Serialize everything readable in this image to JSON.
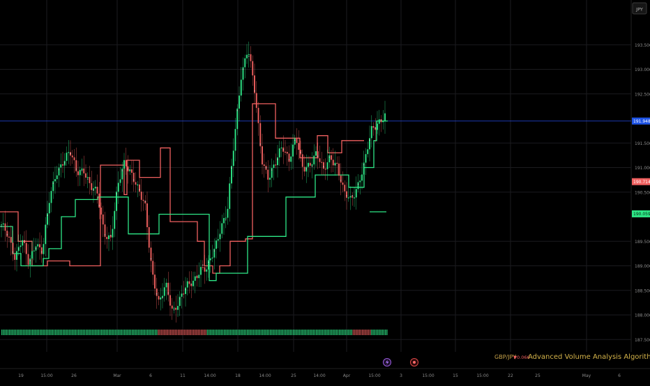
{
  "currency_badge": "JPY",
  "symbol": "GBP/JPY",
  "change": "▼0.066",
  "indicator_title": "Advanced Volume Analysis Algorithm",
  "event_icons": [
    "lightning-icon",
    "dividend-icon"
  ],
  "colors": {
    "background": "#000000",
    "grid": "#1b1b1f",
    "up": "#2ee887",
    "down": "#f0605f",
    "text": "#8a8a8a",
    "price_line": "#2951ff",
    "current_badge": "#1e53e5",
    "title": "#d4b34a"
  },
  "chart_data": {
    "type": "candlestick",
    "ylim": [
      187.2,
      194.1
    ],
    "y_ticks": [
      "193.500",
      "193.000",
      "192.500",
      "191.500",
      "191.000",
      "190.500",
      "189.500",
      "189.000",
      "188.500",
      "188.000",
      "187.500"
    ],
    "x_ticks": [
      "19",
      "15:00",
      "26",
      "Mar",
      "6",
      "11",
      "14:00",
      "18",
      "14:00",
      "25",
      "14:00",
      "Apr",
      "15:00",
      "3",
      "15:00",
      "15",
      "15:00",
      "22",
      "25",
      "May",
      "6"
    ],
    "price_labels": [
      {
        "label": "191.948",
        "value": 191.948,
        "style": "current"
      },
      {
        "label": "190.714",
        "value": 190.714,
        "style": "resistance"
      },
      {
        "label": "190.059",
        "value": 190.059,
        "style": "support"
      }
    ],
    "key_points": [
      189.8,
      189.6,
      189.2,
      189.55,
      189.0,
      189.5,
      189.3,
      190.3,
      190.9,
      191.15,
      191.3,
      190.9,
      191.0,
      190.6,
      190.45,
      189.7,
      189.55,
      190.6,
      191.15,
      190.9,
      190.5,
      190.2,
      188.9,
      188.2,
      188.6,
      188.1,
      188.3,
      188.55,
      188.7,
      188.95,
      188.9,
      189.3,
      189.8,
      190.1,
      191.55,
      192.9,
      193.45,
      192.5,
      191.2,
      190.8,
      191.05,
      191.45,
      191.2,
      191.6,
      190.95,
      191.1,
      191.3,
      190.9,
      191.25,
      191.05,
      190.45,
      190.35,
      190.65,
      191.05,
      191.75,
      191.95,
      192.05
    ],
    "resistance_line": [
      [
        0,
        190.1
      ],
      [
        26,
        190.1
      ],
      [
        26,
        189.5
      ],
      [
        46,
        189.5
      ],
      [
        46,
        189.0
      ],
      [
        68,
        189.0
      ],
      [
        68,
        189.1
      ],
      [
        100,
        189.1
      ],
      [
        100,
        189.0
      ],
      [
        144,
        189.0
      ],
      [
        144,
        191.05
      ],
      [
        178,
        191.05
      ],
      [
        178,
        190.45
      ],
      [
        182,
        190.45
      ],
      [
        182,
        191.15
      ],
      [
        200,
        191.15
      ],
      [
        200,
        190.8
      ],
      [
        230,
        190.8
      ],
      [
        230,
        191.4
      ],
      [
        244,
        191.4
      ],
      [
        244,
        189.9
      ],
      [
        283,
        189.9
      ],
      [
        283,
        189.5
      ],
      [
        293,
        189.5
      ],
      [
        293,
        189.0
      ],
      [
        305,
        189.0
      ],
      [
        305,
        188.85
      ],
      [
        315,
        188.85
      ],
      [
        315,
        189.0
      ],
      [
        330,
        189.0
      ],
      [
        330,
        189.5
      ],
      [
        352,
        189.5
      ],
      [
        352,
        189.55
      ],
      [
        362,
        189.55
      ],
      [
        362,
        192.3
      ],
      [
        395,
        192.3
      ],
      [
        395,
        191.6
      ],
      [
        430,
        191.6
      ],
      [
        430,
        191.2
      ],
      [
        455,
        191.2
      ],
      [
        455,
        191.65
      ],
      [
        470,
        191.65
      ],
      [
        470,
        191.3
      ],
      [
        490,
        191.3
      ],
      [
        490,
        191.55
      ],
      [
        522,
        191.55
      ]
    ],
    "support_line": [
      [
        0,
        189.8
      ],
      [
        18,
        189.8
      ],
      [
        18,
        189.25
      ],
      [
        30,
        189.25
      ],
      [
        30,
        189.0
      ],
      [
        62,
        189.0
      ],
      [
        62,
        189.15
      ],
      [
        70,
        189.15
      ],
      [
        70,
        189.35
      ],
      [
        88,
        189.35
      ],
      [
        88,
        190.0
      ],
      [
        108,
        190.0
      ],
      [
        108,
        190.35
      ],
      [
        140,
        190.35
      ],
      [
        140,
        190.4
      ],
      [
        184,
        190.4
      ],
      [
        184,
        189.65
      ],
      [
        228,
        189.65
      ],
      [
        228,
        190.05
      ],
      [
        300,
        190.05
      ],
      [
        300,
        188.7
      ],
      [
        310,
        188.7
      ],
      [
        310,
        188.85
      ],
      [
        355,
        188.85
      ],
      [
        355,
        189.6
      ],
      [
        410,
        189.6
      ],
      [
        410,
        190.4
      ],
      [
        452,
        190.4
      ],
      [
        452,
        190.85
      ],
      [
        500,
        190.85
      ],
      [
        500,
        190.6
      ],
      [
        522,
        190.6
      ],
      [
        522,
        191.0
      ],
      [
        536,
        191.0
      ],
      [
        536,
        191.55
      ],
      [
        540,
        191.55
      ],
      [
        540,
        191.95
      ],
      [
        556,
        191.95
      ]
    ],
    "support_segment_2": [
      [
        530,
        190.1
      ],
      [
        554,
        190.1
      ]
    ],
    "volume_bar": {
      "x_start": 2,
      "x_end": 555,
      "red_ranges": [
        [
          225,
          295
        ],
        [
          505,
          530
        ]
      ]
    }
  }
}
